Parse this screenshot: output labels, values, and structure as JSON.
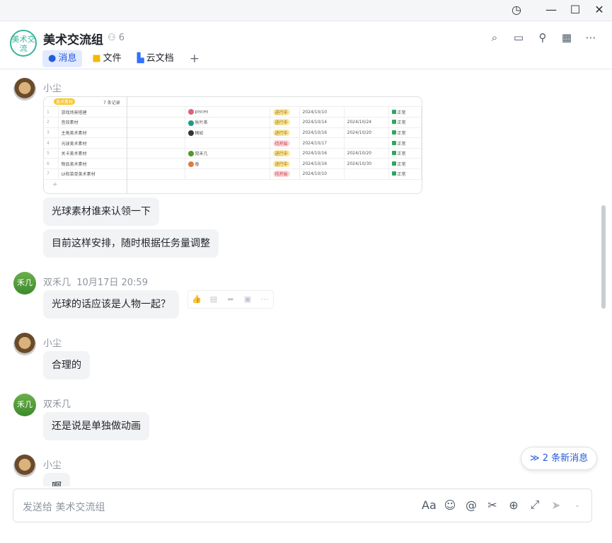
{
  "window": {
    "history": "◷",
    "min": "—",
    "max": "☐",
    "close": "✕"
  },
  "group": {
    "avatar_text": "美术交流",
    "name": "美术交流组",
    "member_count": "6"
  },
  "tabs": [
    {
      "label": "消息",
      "icon": "●"
    },
    {
      "label": "文件",
      "icon": "■"
    },
    {
      "label": "云文档",
      "icon": "▙"
    }
  ],
  "tab_add": "+",
  "card": {
    "group_tag": "美术素材",
    "record_count": "7 条记录",
    "rows": [
      {
        "n": "1",
        "task": "游戏场景搭建",
        "owner": "pisces",
        "owner_color": "#e0607a",
        "status": "进行中",
        "start": "2024/10/10",
        "end": "",
        "flag": "正常"
      },
      {
        "n": "2",
        "task": "音效素材",
        "owner": "秋叶茶",
        "owner_color": "#1f9a8a",
        "status": "进行中",
        "start": "2024/10/14",
        "end": "2024/10/24",
        "flag": "正常"
      },
      {
        "n": "3",
        "task": "主角美术素材",
        "owner": "楠如",
        "owner_color": "#3a3030",
        "status": "进行中",
        "start": "2024/10/16",
        "end": "2024/10/20",
        "flag": "正常"
      },
      {
        "n": "4",
        "task": "光球美术素材",
        "owner": "",
        "owner_color": "",
        "status": "待开始",
        "start": "2024/10/17",
        "end": "",
        "flag": "正常"
      },
      {
        "n": "5",
        "task": "关卡美术素材",
        "owner": "双禾几",
        "owner_color": "#4f9a2a",
        "status": "进行中",
        "start": "2024/10/16",
        "end": "2024/10/20",
        "flag": "正常"
      },
      {
        "n": "6",
        "task": "物品美术素材",
        "owner": "敖",
        "owner_color": "#e07a40",
        "status": "进行中",
        "start": "2024/10/16",
        "end": "2024/10/30",
        "flag": "正常"
      },
      {
        "n": "7",
        "task": "UI和菜单美术素材",
        "owner": "",
        "owner_color": "",
        "status": "待开始",
        "start": "2024/10/10",
        "end": "",
        "flag": "正常"
      }
    ]
  },
  "messages": {
    "m1_sender": "小尘",
    "m1_b1": "光球素材谁来认领一下",
    "m1_b2": "目前这样安排，随时根据任务量调整",
    "m2_sender": "双禾几",
    "m2_time": "10月17日 20:59",
    "m2_avatar": "禾几",
    "m2_b1": "光球的话应该是人物一起？",
    "m3_sender": "小尘",
    "m3_b1": "合理的",
    "m4_sender": "双禾几",
    "m4_avatar": "禾几",
    "m4_b1": "还是说是单独做动画",
    "m5_sender": "小尘",
    "m5_b1": "啊"
  },
  "new_messages": "≫ 2 条新消息",
  "composer": {
    "placeholder": "发送给 美术交流组"
  }
}
